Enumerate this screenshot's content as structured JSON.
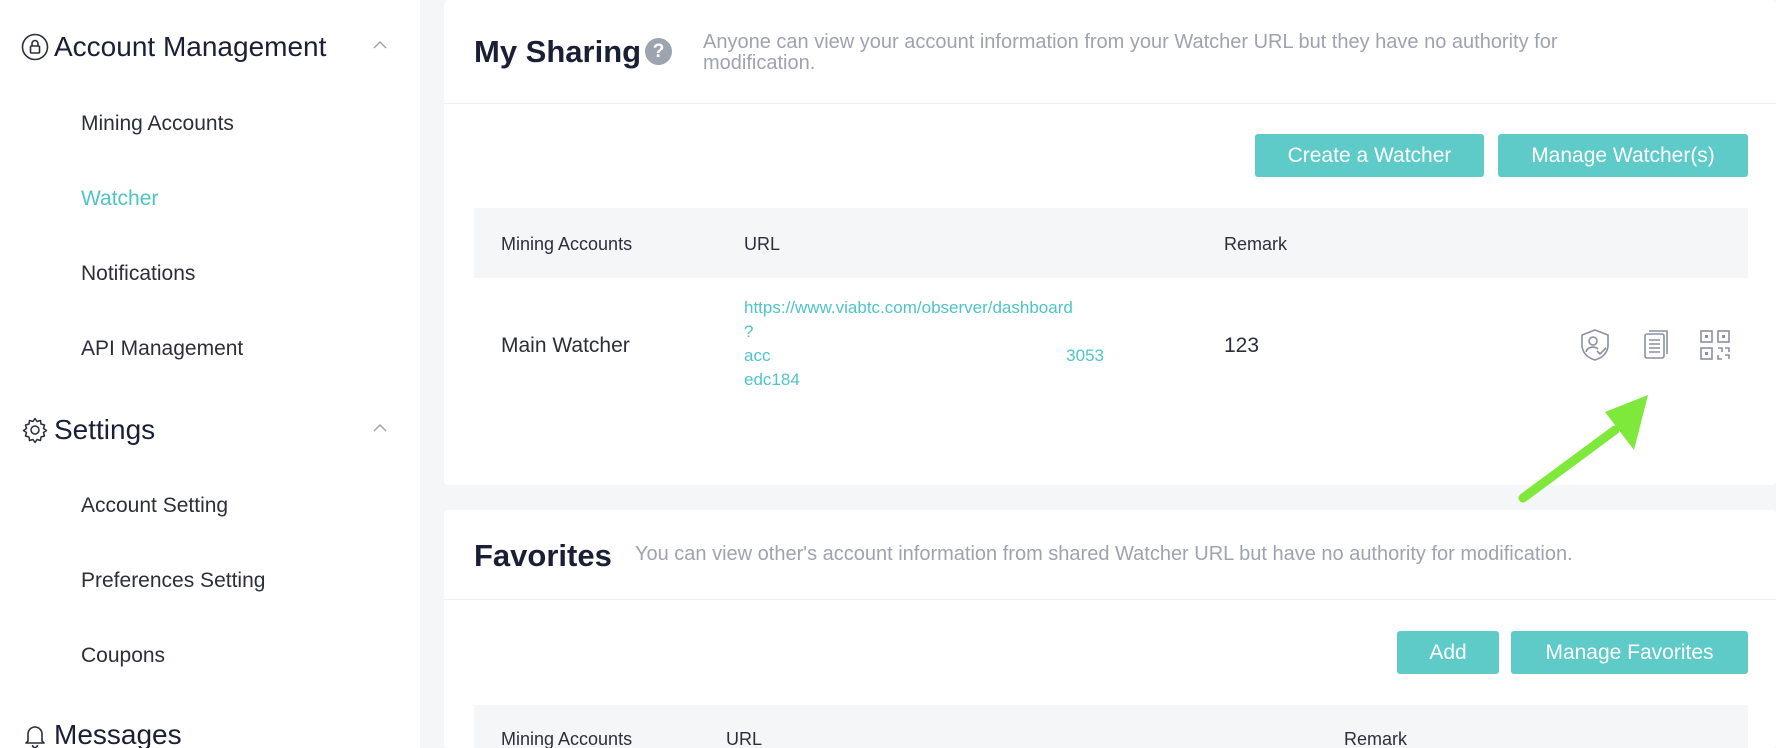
{
  "sidebar": {
    "account_management": {
      "title": "Account Management",
      "items": [
        "Mining Accounts",
        "Watcher",
        "Notifications",
        "API Management"
      ],
      "active": "Watcher"
    },
    "settings": {
      "title": "Settings",
      "items": [
        "Account Setting",
        "Preferences Setting",
        "Coupons"
      ]
    },
    "messages": {
      "title": "Messages"
    }
  },
  "my_sharing": {
    "title": "My Sharing",
    "help": "?",
    "description_line1": "Anyone can view your account information from your Watcher URL but they have no authority for",
    "description_line2": "modification.",
    "create_button": "Create a Watcher",
    "manage_button": "Manage Watcher(s)",
    "columns": {
      "account": "Mining Accounts",
      "url": "URL",
      "remark": "Remark"
    },
    "rows": [
      {
        "account": "Main Watcher",
        "url_line1": "https://www.viabtc.com/observer/dashboard",
        "url_line2": "?",
        "url_line3a": "acc",
        "url_line3b": "3053",
        "url_line4": "edc184",
        "remark": "123",
        "actions": [
          "permission-icon",
          "copy-icon",
          "qrcode-icon"
        ]
      }
    ]
  },
  "favorites": {
    "title": "Favorites",
    "description": "You can view other's account information from shared Watcher URL but have no authority for modification.",
    "add_button": "Add",
    "manage_button": "Manage Favorites",
    "columns": {
      "account": "Mining Accounts",
      "url": "URL",
      "remark": "Remark"
    }
  },
  "colors": {
    "accent": "#5ecbc9",
    "link": "#4fc4c7",
    "arrow": "#7ee83b"
  }
}
